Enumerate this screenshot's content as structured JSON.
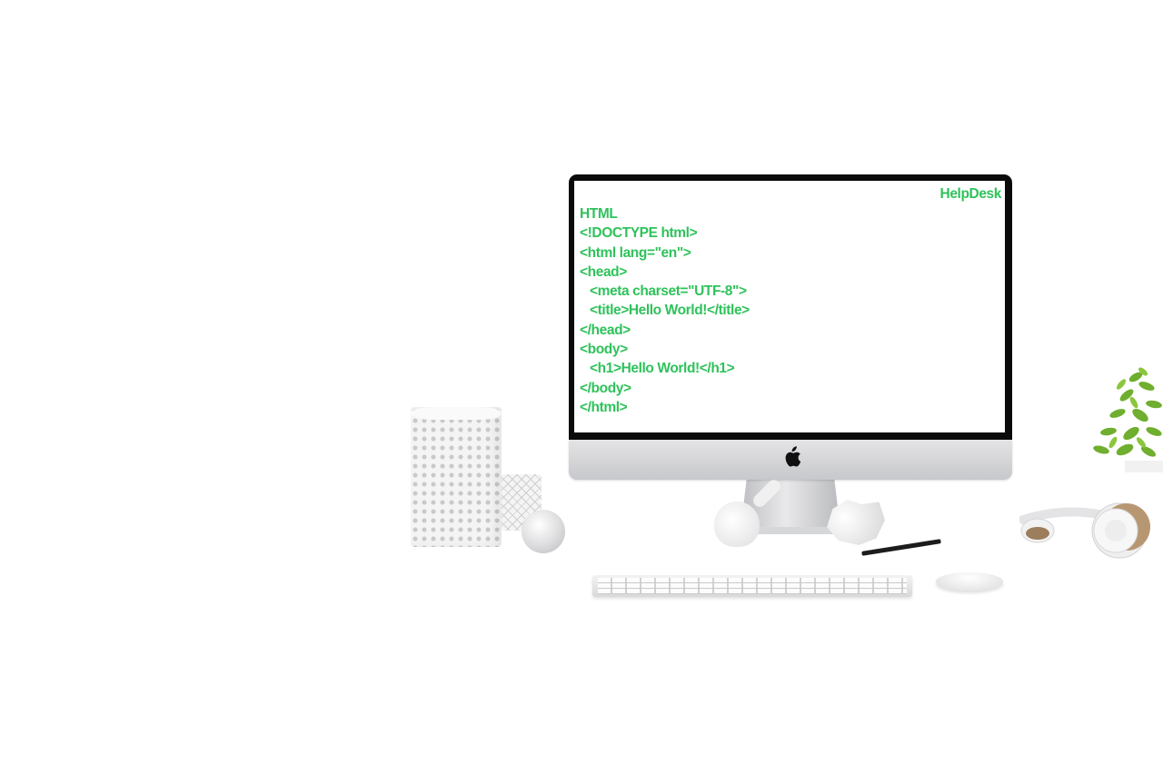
{
  "screen": {
    "brand": "HelpDesk",
    "code_lines": [
      {
        "text": "HTML",
        "indent": false
      },
      {
        "text": "<!DOCTYPE html>",
        "indent": false
      },
      {
        "text": "<html lang=\"en\">",
        "indent": false
      },
      {
        "text": "<head>",
        "indent": false
      },
      {
        "text": "<meta charset=\"UTF-8\">",
        "indent": true
      },
      {
        "text": "<title>Hello World!</title>",
        "indent": true
      },
      {
        "text": "</head>",
        "indent": false
      },
      {
        "text": "<body>",
        "indent": false
      },
      {
        "text": "<h1>Hello World!</h1>",
        "indent": true
      },
      {
        "text": "</body>",
        "indent": false
      },
      {
        "text": "</html>",
        "indent": false
      }
    ],
    "text_color": "#2fc25b"
  },
  "objects": {
    "logo_icon": "apple-logo-icon"
  }
}
